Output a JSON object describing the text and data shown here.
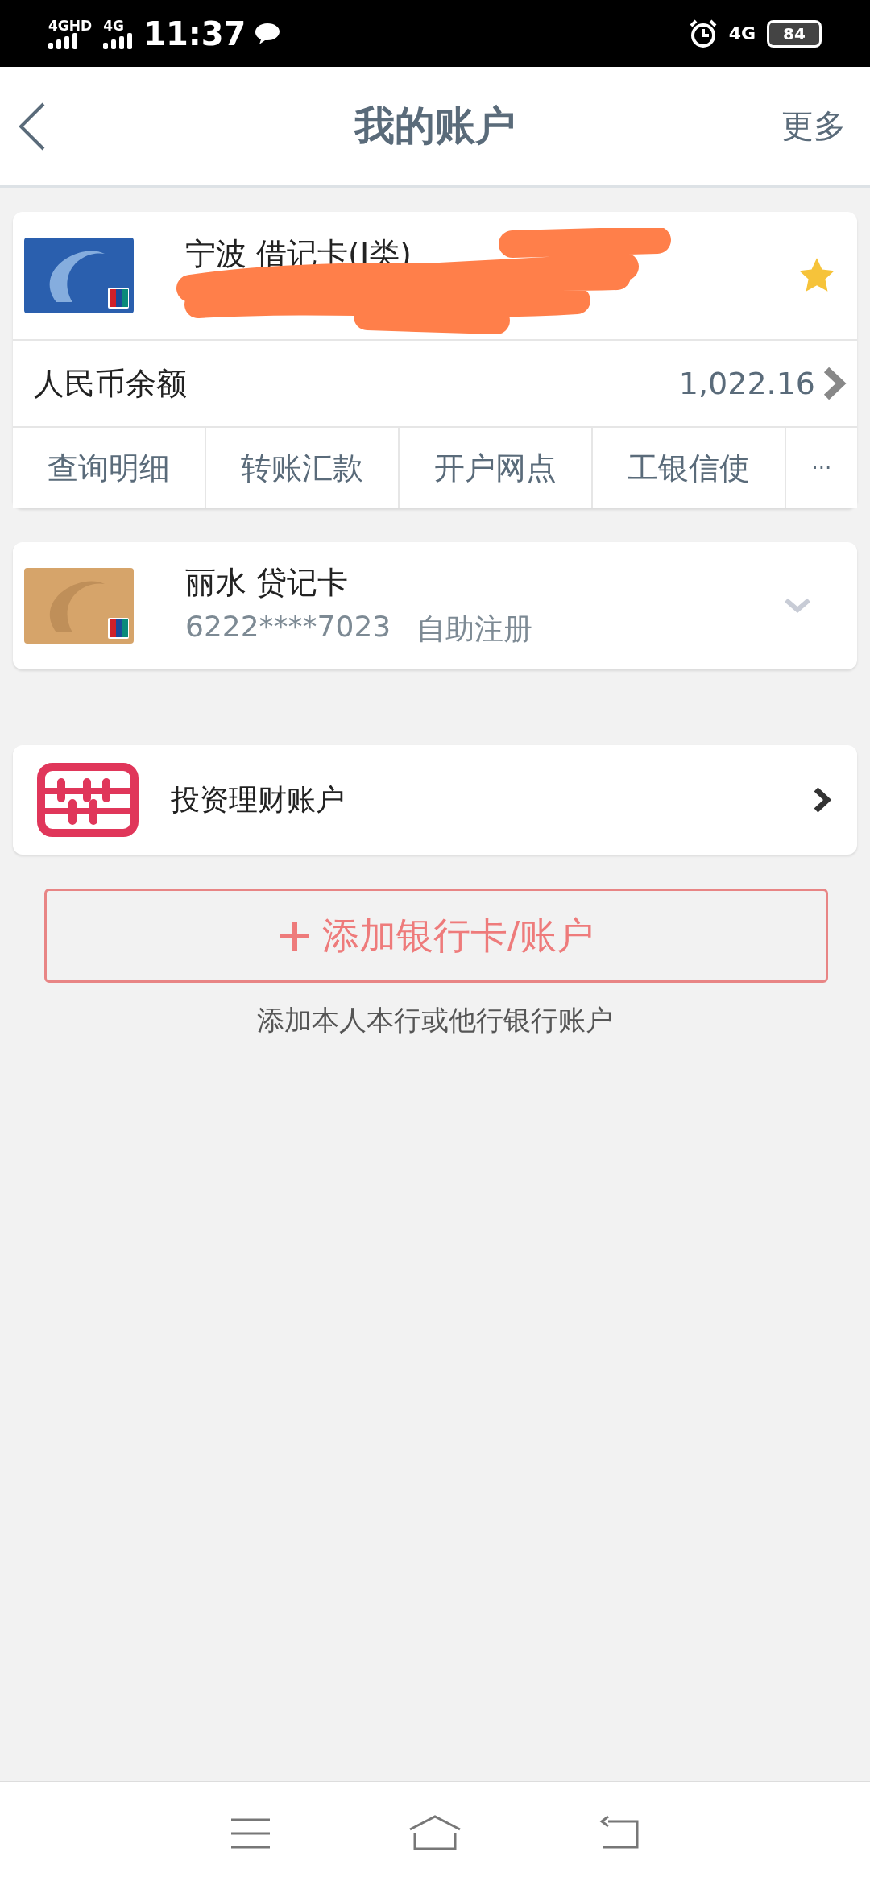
{
  "status_bar": {
    "signal_1": "4GHD",
    "signal_2": "4G",
    "time": "11:37",
    "network": "4G",
    "battery": "84"
  },
  "header": {
    "title": "我的账户",
    "action": "更多"
  },
  "accounts": [
    {
      "kind": "debit",
      "name": "宁波 借记卡(I类)",
      "starred": true,
      "expanded": true,
      "redacted": true,
      "balance_label": "人民币余额",
      "balance": "1,022.16",
      "actions": [
        "查询明细",
        "转账汇款",
        "开户网点",
        "工银信使",
        "···"
      ]
    },
    {
      "kind": "credit",
      "name": "丽水 贷记卡",
      "starred": false,
      "expanded": false,
      "redacted": false,
      "number": "6222****7023",
      "status": "自助注册"
    }
  ],
  "investment": {
    "label": "投资理财账户"
  },
  "add_button": {
    "label": "添加银行卡/账户"
  },
  "add_hint": "添加本人本行或他行银行账户"
}
